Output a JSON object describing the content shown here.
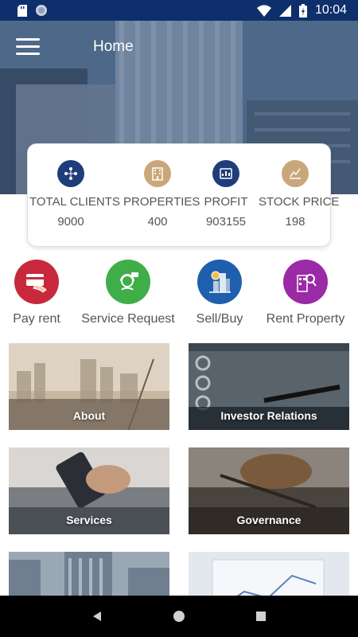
{
  "status_bar": {
    "time": "10:04"
  },
  "header": {
    "title": "Home"
  },
  "stats": [
    {
      "label": "TOTAL CLIENTS",
      "value": "9000",
      "icon": "clients-icon",
      "color": "#1f3d7a"
    },
    {
      "label": "PROPERTIES",
      "value": "400",
      "icon": "building-icon",
      "color": "#c9a77a"
    },
    {
      "label": "PROFIT",
      "value": "903155",
      "icon": "profit-icon",
      "color": "#1f3d7a"
    },
    {
      "label": "STOCK PRICE",
      "value": "198",
      "icon": "stock-chart-icon",
      "color": "#c9a77a"
    }
  ],
  "actions": [
    {
      "label": "Pay rent",
      "icon": "card-payment-icon",
      "color": "#c8283c"
    },
    {
      "label": "Service Request",
      "icon": "support-agent-icon",
      "color": "#3fae49"
    },
    {
      "label": "Sell/Buy",
      "icon": "buildings-money-icon",
      "color": "#1f5fae"
    },
    {
      "label": "Rent Property",
      "icon": "search-building-icon",
      "color": "#9b2aa6"
    }
  ],
  "tiles": [
    {
      "label": "About"
    },
    {
      "label": "Investor Relations"
    },
    {
      "label": "Services"
    },
    {
      "label": "Governance"
    },
    {
      "label": ""
    },
    {
      "label": ""
    }
  ]
}
